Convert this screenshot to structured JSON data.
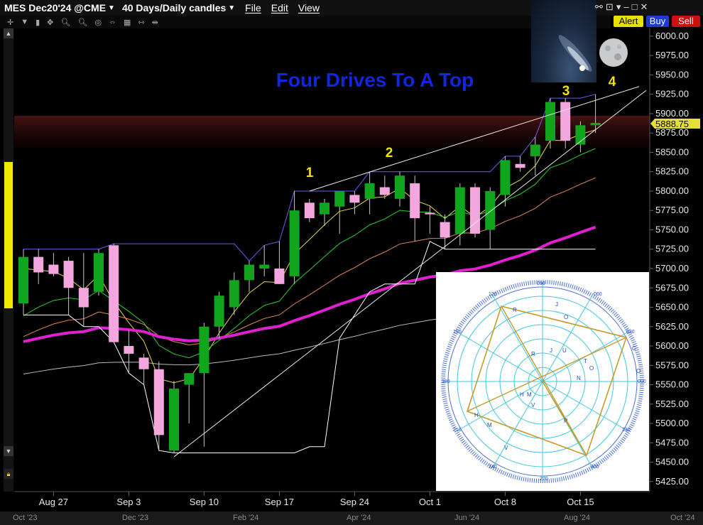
{
  "titlebar": {
    "symbol": "MES Dec20'24 @CME",
    "period": "40 Days/Daily candles",
    "menus": [
      "File",
      "Edit",
      "View"
    ]
  },
  "buttons": {
    "alert": "Alert",
    "buy": "Buy",
    "sell": "Sell"
  },
  "chart": {
    "annotation": "Four Drives To A Top",
    "drive_labels": [
      "1",
      "2",
      "3",
      "4"
    ],
    "price_label": "5888.75",
    "y_ticks": [
      "6000.00",
      "5975.00",
      "5950.00",
      "5925.00",
      "5900.00",
      "5875.00",
      "5850.00",
      "5825.00",
      "5800.00",
      "5775.00",
      "5750.00",
      "5725.00",
      "5700.00",
      "5675.00",
      "5650.00",
      "5625.00",
      "5600.00",
      "5575.00",
      "5550.00",
      "5525.00",
      "5500.00",
      "5475.00",
      "5450.00",
      "5425.00"
    ],
    "x_ticks": [
      "Aug 27",
      "Sep 3",
      "Sep 10",
      "Sep 17",
      "Sep 24",
      "Oct 1",
      "Oct 8",
      "Oct 15"
    ],
    "nav_ticks": [
      "Oct '23",
      "Dec '23",
      "Feb '24",
      "Apr '24",
      "Jun '24",
      "Aug '24",
      "Oct '24"
    ]
  },
  "chart_data": {
    "type": "candlestick",
    "title": "Four Drives To A Top",
    "ylim": [
      5412,
      6010
    ],
    "last_price": 5888.75,
    "candles": [
      {
        "o": 5655,
        "h": 5725,
        "l": 5640,
        "c": 5715
      },
      {
        "o": 5715,
        "h": 5725,
        "l": 5680,
        "c": 5695
      },
      {
        "o": 5705,
        "h": 5720,
        "l": 5690,
        "c": 5693
      },
      {
        "o": 5710,
        "h": 5715,
        "l": 5640,
        "c": 5675
      },
      {
        "o": 5675,
        "h": 5720,
        "l": 5625,
        "c": 5650
      },
      {
        "o": 5670,
        "h": 5725,
        "l": 5665,
        "c": 5720
      },
      {
        "o": 5730,
        "h": 5732,
        "l": 5605,
        "c": 5605
      },
      {
        "o": 5600,
        "h": 5620,
        "l": 5565,
        "c": 5590
      },
      {
        "o": 5585,
        "h": 5590,
        "l": 5550,
        "c": 5570
      },
      {
        "o": 5570,
        "h": 5580,
        "l": 5465,
        "c": 5485
      },
      {
        "o": 5465,
        "h": 5555,
        "l": 5462,
        "c": 5545
      },
      {
        "o": 5550,
        "h": 5565,
        "l": 5500,
        "c": 5565
      },
      {
        "o": 5565,
        "h": 5630,
        "l": 5470,
        "c": 5625
      },
      {
        "o": 5625,
        "h": 5670,
        "l": 5610,
        "c": 5665
      },
      {
        "o": 5650,
        "h": 5695,
        "l": 5640,
        "c": 5685
      },
      {
        "o": 5685,
        "h": 5710,
        "l": 5670,
        "c": 5705
      },
      {
        "o": 5700,
        "h": 5730,
        "l": 5690,
        "c": 5705
      },
      {
        "o": 5700,
        "h": 5735,
        "l": 5680,
        "c": 5680
      },
      {
        "o": 5690,
        "h": 5800,
        "l": 5680,
        "c": 5775
      },
      {
        "o": 5785,
        "h": 5790,
        "l": 5760,
        "c": 5765
      },
      {
        "o": 5770,
        "h": 5790,
        "l": 5755,
        "c": 5785
      },
      {
        "o": 5780,
        "h": 5800,
        "l": 5745,
        "c": 5800
      },
      {
        "o": 5795,
        "h": 5800,
        "l": 5770,
        "c": 5785
      },
      {
        "o": 5790,
        "h": 5825,
        "l": 5770,
        "c": 5810
      },
      {
        "o": 5805,
        "h": 5820,
        "l": 5790,
        "c": 5795
      },
      {
        "o": 5790,
        "h": 5825,
        "l": 5780,
        "c": 5820
      },
      {
        "o": 5810,
        "h": 5820,
        "l": 5735,
        "c": 5765
      },
      {
        "o": 5772,
        "h": 5780,
        "l": 5745,
        "c": 5770
      },
      {
        "o": 5760,
        "h": 5770,
        "l": 5725,
        "c": 5740
      },
      {
        "o": 5745,
        "h": 5810,
        "l": 5730,
        "c": 5805
      },
      {
        "o": 5805,
        "h": 5810,
        "l": 5740,
        "c": 5745
      },
      {
        "o": 5750,
        "h": 5805,
        "l": 5725,
        "c": 5800
      },
      {
        "o": 5795,
        "h": 5845,
        "l": 5780,
        "c": 5840
      },
      {
        "o": 5835,
        "h": 5845,
        "l": 5825,
        "c": 5830
      },
      {
        "o": 5845,
        "h": 5870,
        "l": 5820,
        "c": 5860
      },
      {
        "o": 5865,
        "h": 5920,
        "l": 5855,
        "c": 5915
      },
      {
        "o": 5915,
        "h": 5920,
        "l": 5855,
        "c": 5865
      },
      {
        "o": 5860,
        "h": 5890,
        "l": 5850,
        "c": 5885
      },
      {
        "o": 5885,
        "h": 5925,
        "l": 5875,
        "c": 5888
      }
    ]
  }
}
